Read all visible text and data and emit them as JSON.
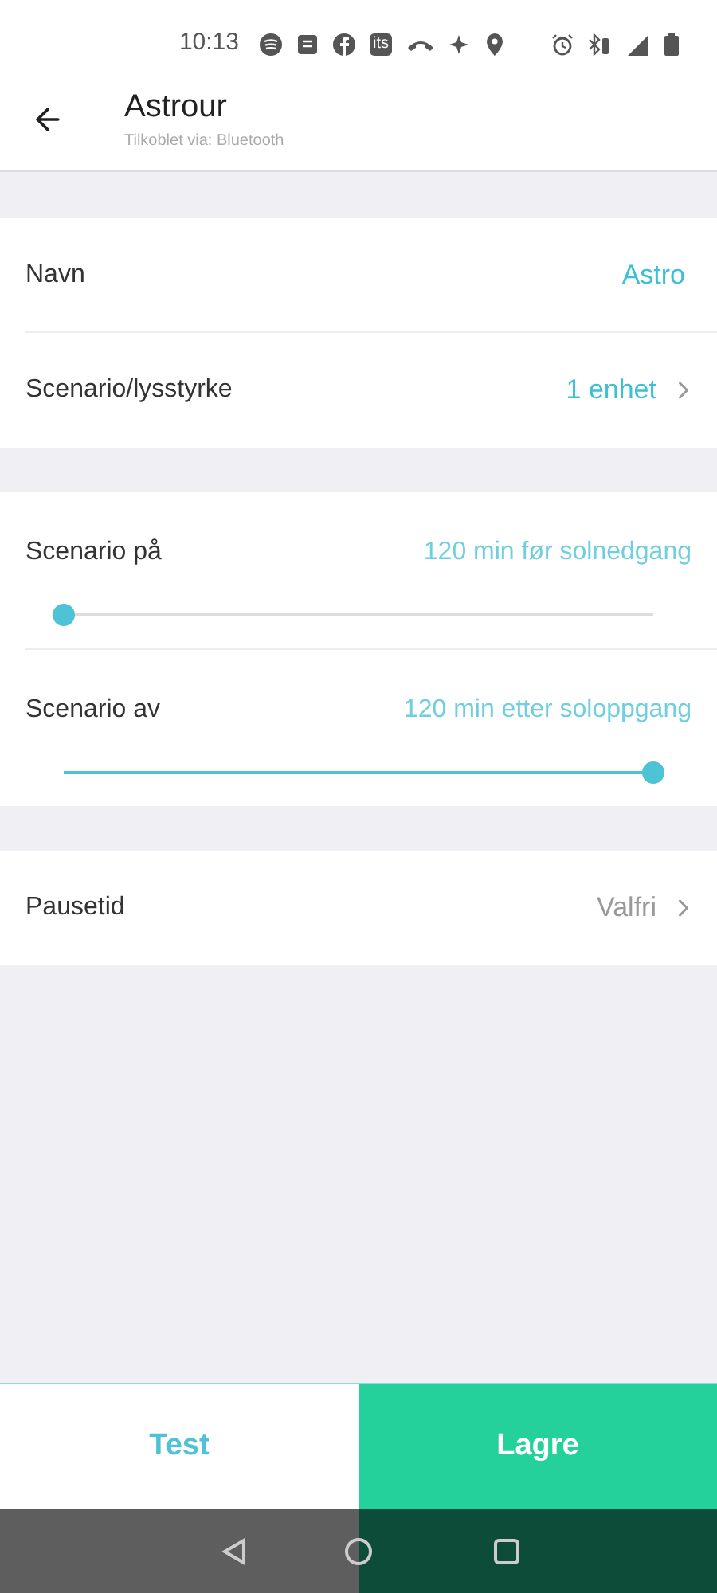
{
  "status_bar": {
    "time": "10:13",
    "app_badge": "its"
  },
  "header": {
    "title": "Astrour",
    "subtitle": "Tilkoblet via: Bluetooth"
  },
  "sections": [
    {
      "rows": [
        {
          "kind": "value",
          "label": "Navn",
          "value": "Astro",
          "chevron": false
        },
        {
          "kind": "value",
          "label": "Scenario/lysstyrke",
          "value": "1 enhet",
          "chevron": true
        }
      ]
    },
    {
      "rows": [
        {
          "kind": "slider",
          "label": "Scenario på",
          "value": "120 min før solnedgang",
          "level": 0
        },
        {
          "kind": "slider",
          "label": "Scenario av",
          "value": "120 min etter soloppgang",
          "level": 1
        }
      ]
    },
    {
      "rows": [
        {
          "kind": "value",
          "label": "Pausetid",
          "value": "Valfri",
          "chevron": true,
          "muted": true
        }
      ]
    }
  ],
  "buttons": [
    {
      "label": "Test",
      "primary": false
    },
    {
      "label": "Lagre",
      "primary": true
    }
  ]
}
